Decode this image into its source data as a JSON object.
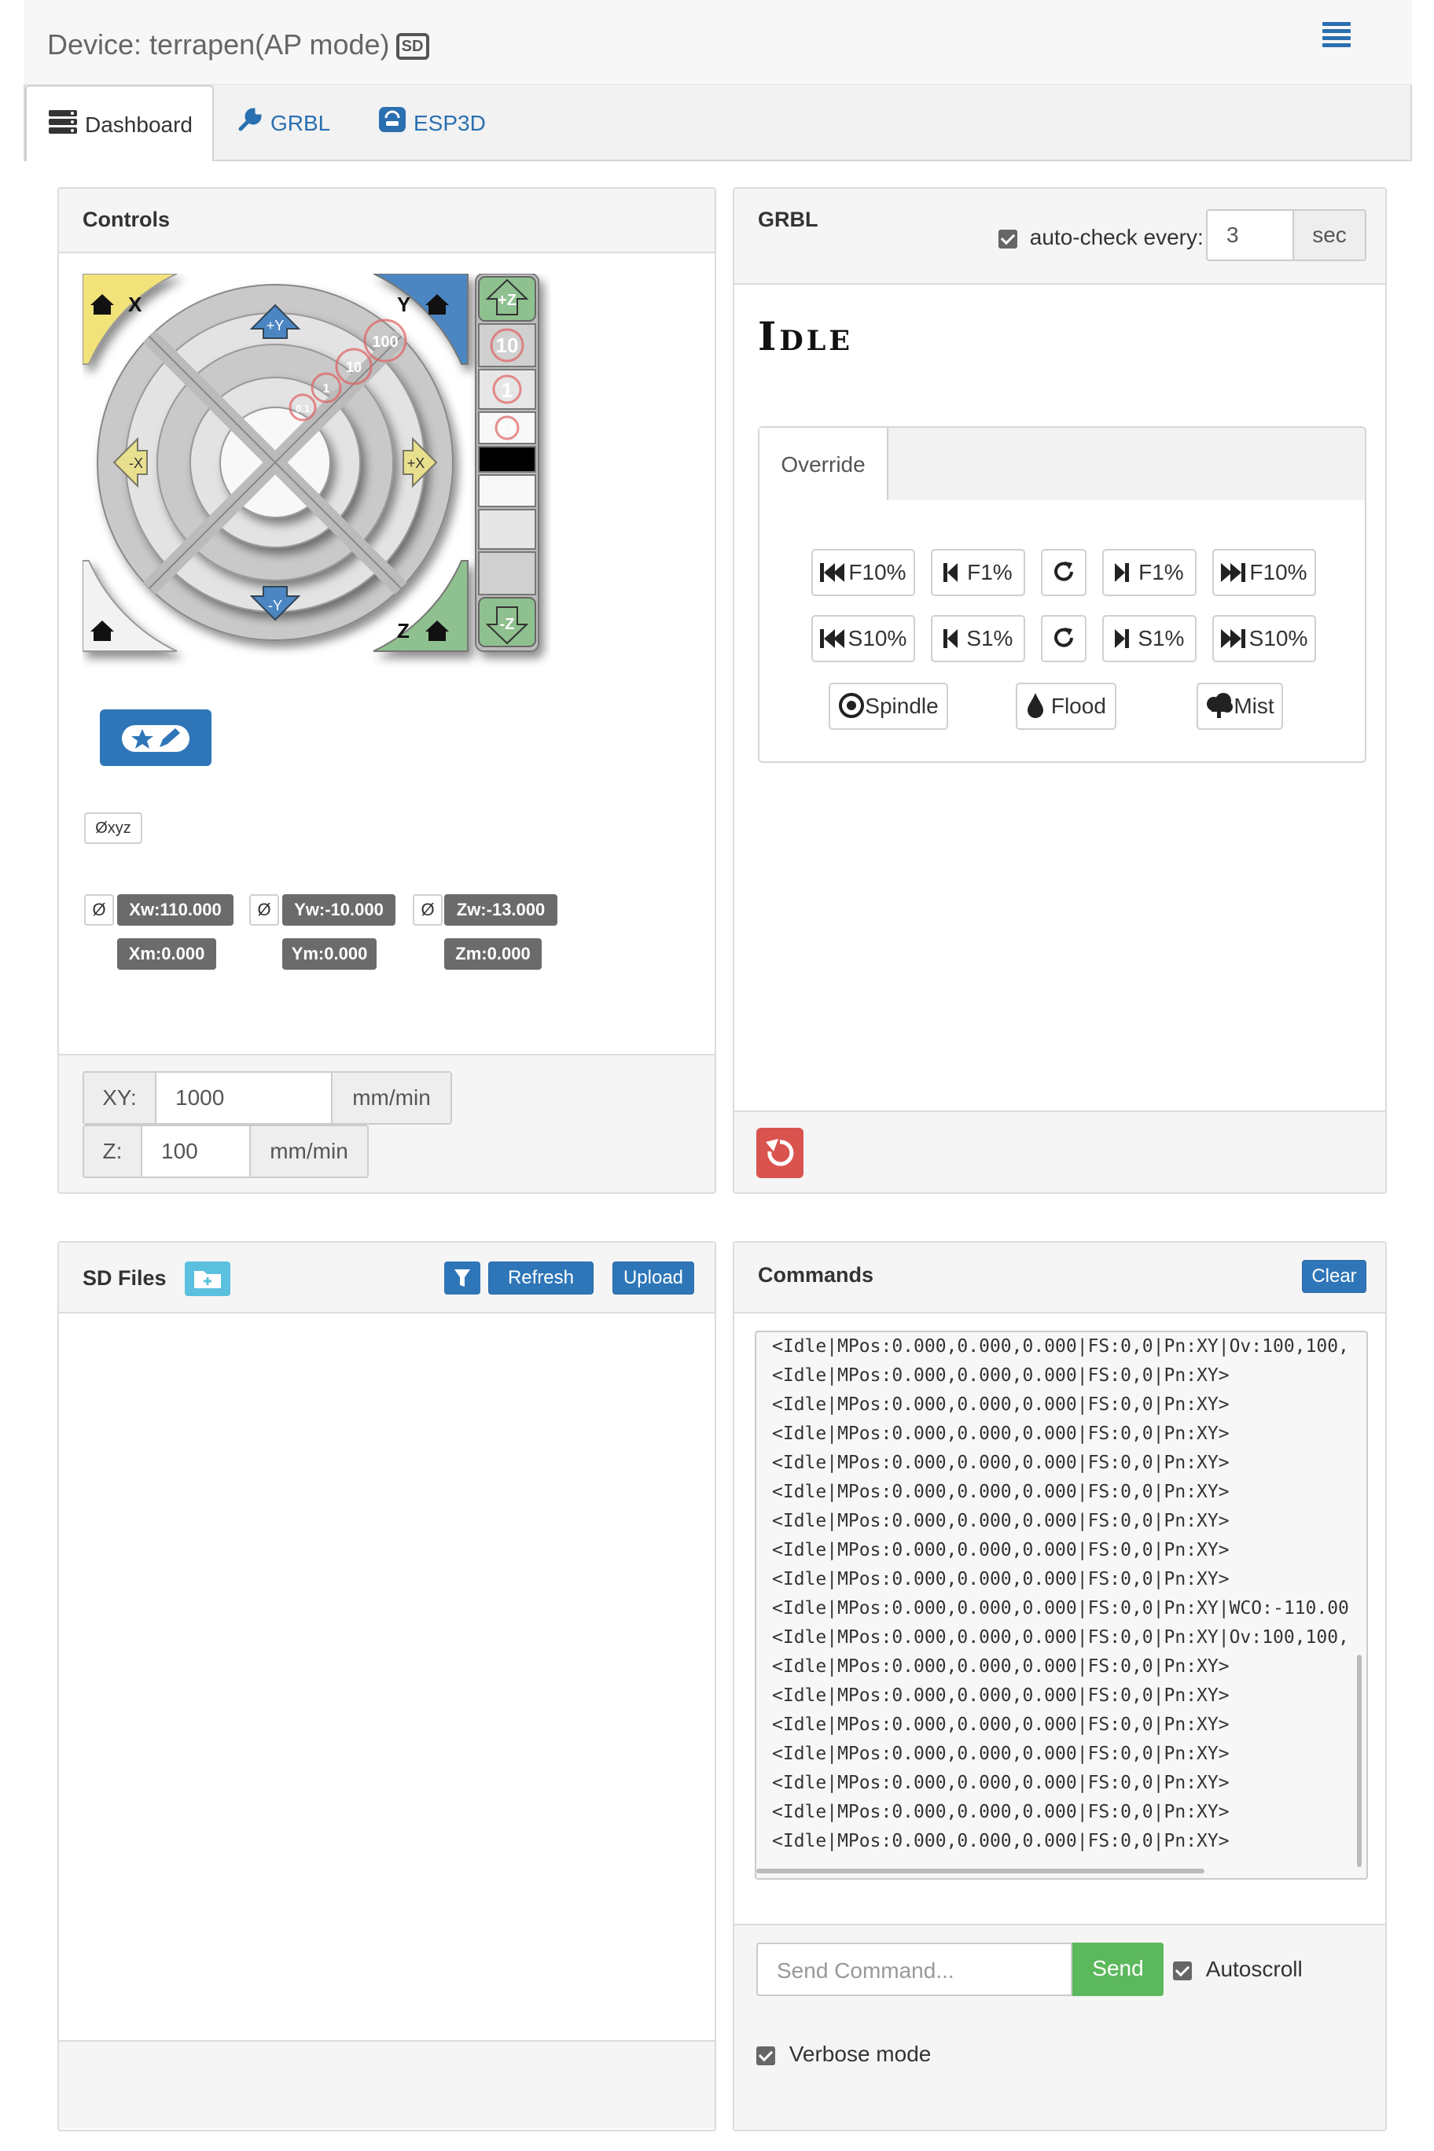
{
  "header": {
    "device_title": "Device: terrapen(AP mode)",
    "sd_badge": "SD"
  },
  "tabs": [
    {
      "label": "Dashboard",
      "icon": "server-icon",
      "active": true
    },
    {
      "label": "GRBL",
      "icon": "wrench-icon",
      "active": false
    },
    {
      "label": "ESP3D",
      "icon": "esp3d-icon",
      "active": false
    }
  ],
  "controls": {
    "title": "Controls",
    "jog": {
      "home_x": "X",
      "home_y": "Y",
      "home_z": "Z",
      "plus_y": "+Y",
      "minus_y": "-Y",
      "plus_x": "+X",
      "minus_x": "-X",
      "plus_z": "+Z",
      "minus_z": "-Z",
      "steps": [
        "100",
        "10",
        "1",
        "0.1"
      ],
      "z_steps": [
        "10",
        "1",
        "0.1"
      ]
    },
    "macro_button_icon": "star-pencil-icon",
    "zero_all_label": "Øxyz",
    "zero_label": "Ø",
    "positions": {
      "xw": "Xw:110.000",
      "yw": "Yw:-10.000",
      "zw": "Zw:-13.000",
      "xm": "Xm:0.000",
      "ym": "Ym:0.000",
      "zm": "Zm:0.000"
    },
    "feed": {
      "xy_label": "XY:",
      "xy_value": "1000",
      "xy_unit": "mm/min",
      "z_label": "Z:",
      "z_value": "100",
      "z_unit": "mm/min"
    }
  },
  "grbl": {
    "title": "GRBL",
    "autocheck_label": "auto-check every:",
    "autocheck_checked": true,
    "autocheck_value": "3",
    "autocheck_unit": "sec",
    "status": "Idle",
    "override_tab": "Override",
    "feed_overrides": [
      "F10%",
      "F1%",
      "F1%",
      "F10%"
    ],
    "spindle_overrides": [
      "S10%",
      "S1%",
      "S1%",
      "S10%"
    ],
    "coolant": [
      "Spindle",
      "Flood",
      "Mist"
    ],
    "reset_color": "#d9534f"
  },
  "sd_files": {
    "title": "SD Files",
    "refresh_label": "Refresh",
    "upload_label": "Upload"
  },
  "commands": {
    "title": "Commands",
    "clear_label": "Clear",
    "console_lines": [
      "<Idle|MPos:0.000,0.000,0.000|FS:0,0|Pn:XY|Ov:100,100,",
      "<Idle|MPos:0.000,0.000,0.000|FS:0,0|Pn:XY>",
      "<Idle|MPos:0.000,0.000,0.000|FS:0,0|Pn:XY>",
      "<Idle|MPos:0.000,0.000,0.000|FS:0,0|Pn:XY>",
      "<Idle|MPos:0.000,0.000,0.000|FS:0,0|Pn:XY>",
      "<Idle|MPos:0.000,0.000,0.000|FS:0,0|Pn:XY>",
      "<Idle|MPos:0.000,0.000,0.000|FS:0,0|Pn:XY>",
      "<Idle|MPos:0.000,0.000,0.000|FS:0,0|Pn:XY>",
      "<Idle|MPos:0.000,0.000,0.000|FS:0,0|Pn:XY>",
      "<Idle|MPos:0.000,0.000,0.000|FS:0,0|Pn:XY|WCO:-110.00",
      "<Idle|MPos:0.000,0.000,0.000|FS:0,0|Pn:XY|Ov:100,100,",
      "<Idle|MPos:0.000,0.000,0.000|FS:0,0|Pn:XY>",
      "<Idle|MPos:0.000,0.000,0.000|FS:0,0|Pn:XY>",
      "<Idle|MPos:0.000,0.000,0.000|FS:0,0|Pn:XY>",
      "<Idle|MPos:0.000,0.000,0.000|FS:0,0|Pn:XY>",
      "<Idle|MPos:0.000,0.000,0.000|FS:0,0|Pn:XY>",
      "<Idle|MPos:0.000,0.000,0.000|FS:0,0|Pn:XY>",
      "<Idle|MPos:0.000,0.000,0.000|FS:0,0|Pn:XY>"
    ],
    "send_placeholder": "Send Command...",
    "send_label": "Send",
    "autoscroll_label": "Autoscroll",
    "autoscroll_checked": true,
    "verbose_label": "Verbose mode",
    "verbose_checked": true
  },
  "colors": {
    "primary": "#2e76b8",
    "success": "#5cb85c",
    "danger": "#d9534f",
    "home_x": "#f2e27a",
    "home_y": "#4b86c2",
    "home_z": "#8fc08f"
  }
}
